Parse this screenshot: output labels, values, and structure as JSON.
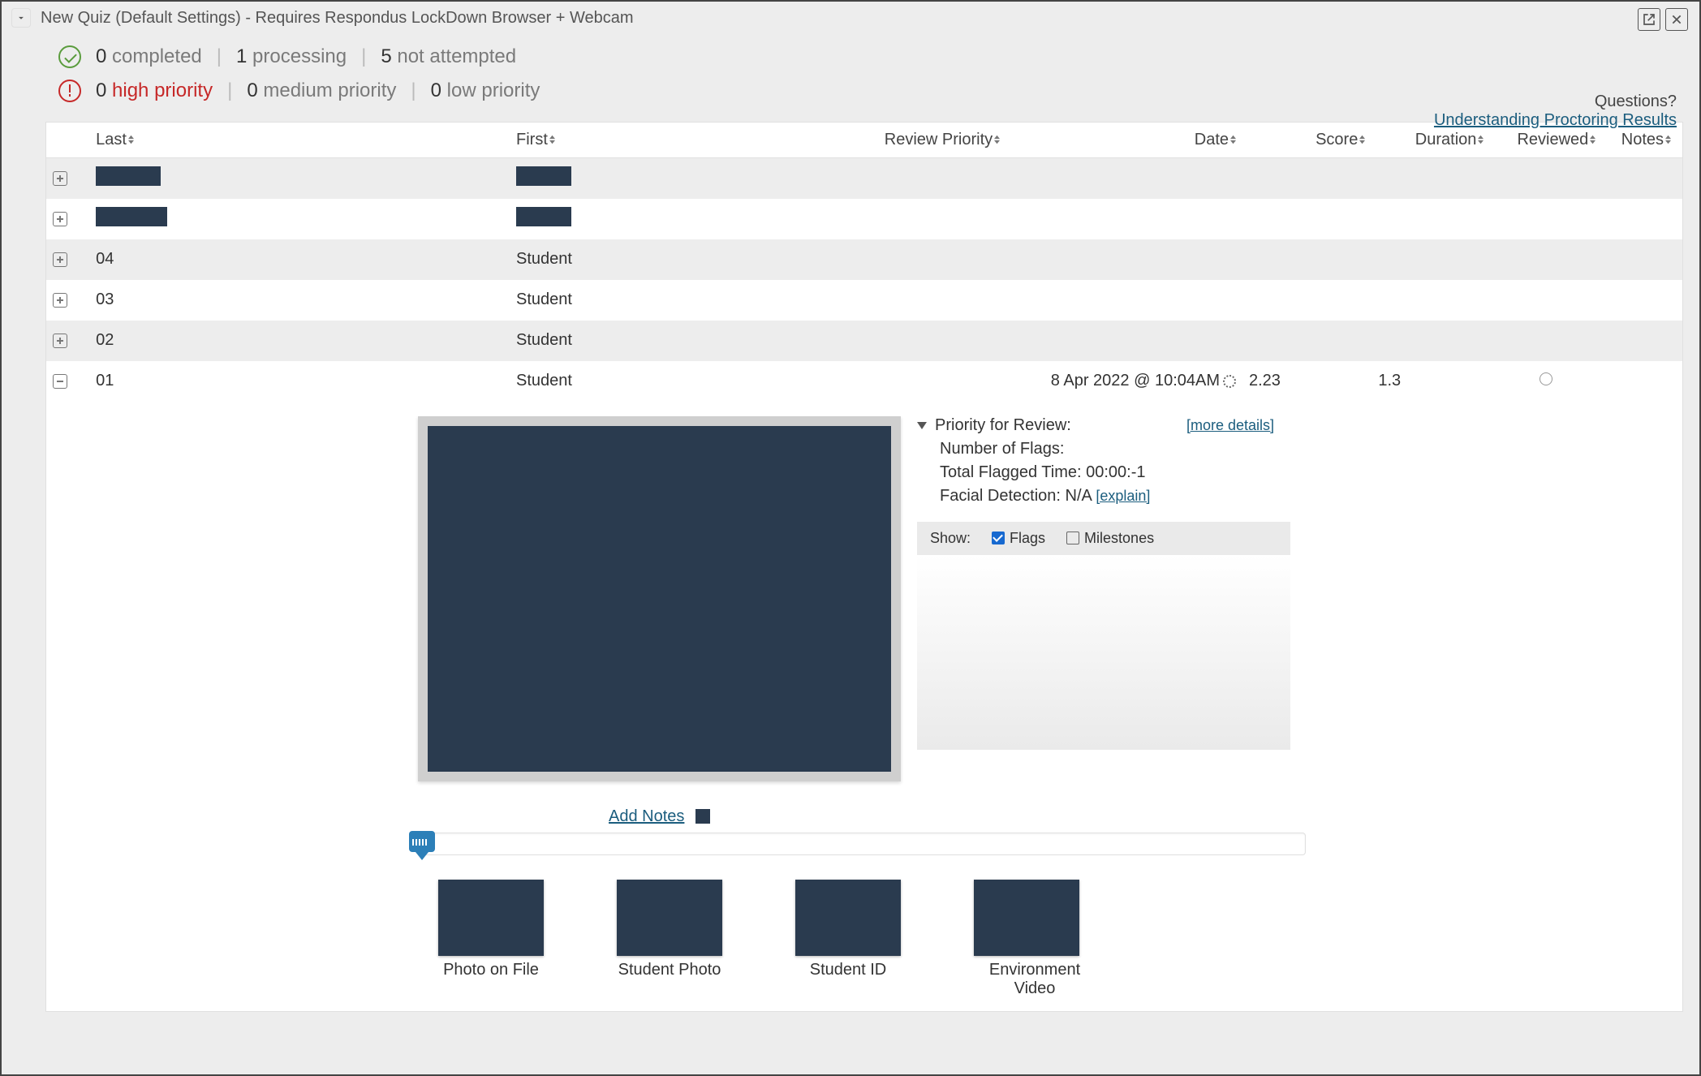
{
  "title": "New Quiz (Default Settings) - Requires Respondus LockDown Browser + Webcam",
  "status": {
    "completed": {
      "count": 0,
      "label": "completed"
    },
    "processing": {
      "count": 1,
      "label": "processing"
    },
    "not_attempted": {
      "count": 5,
      "label": "not attempted"
    },
    "high": {
      "count": 0,
      "label": "high priority"
    },
    "medium": {
      "count": 0,
      "label": "medium priority"
    },
    "low": {
      "count": 0,
      "label": "low priority"
    }
  },
  "help": {
    "question": "Questions?",
    "link": "Understanding Proctoring Results"
  },
  "columns": {
    "last": "Last",
    "first": "First",
    "review_priority": "Review Priority",
    "date": "Date",
    "score": "Score",
    "duration": "Duration",
    "reviewed": "Reviewed",
    "notes": "Notes"
  },
  "rows": [
    {
      "last": "",
      "first": "",
      "redacted": true
    },
    {
      "last": "",
      "first": "",
      "redacted": true
    },
    {
      "last": "04",
      "first": "Student"
    },
    {
      "last": "03",
      "first": "Student"
    },
    {
      "last": "02",
      "first": "Student"
    },
    {
      "last": "01",
      "first": "Student",
      "date": "8 Apr 2022 @ 10:04AM",
      "score": "2.23",
      "duration": "1.3",
      "expanded": true
    }
  ],
  "detail": {
    "priority_label": "Priority for Review:",
    "more_details": "[more details]",
    "flags_label": "Number of Flags:",
    "flagged_time_label": "Total Flagged Time:",
    "flagged_time_value": "00:00:-1",
    "facial_label": "Facial Detection:",
    "facial_value": "N/A",
    "explain": "[explain]",
    "show_label": "Show:",
    "flags_cb": "Flags",
    "milestones_cb": "Milestones",
    "add_notes": "Add Notes"
  },
  "thumbs": [
    {
      "label": "Photo on File"
    },
    {
      "label": "Student Photo"
    },
    {
      "label": "Student ID"
    },
    {
      "label": "Environment Video"
    }
  ]
}
